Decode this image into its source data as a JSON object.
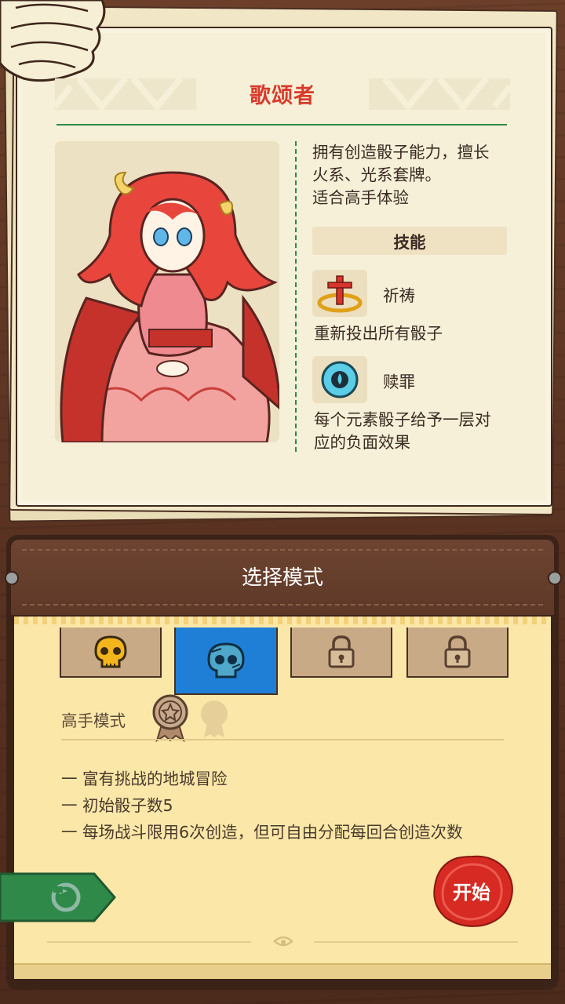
{
  "character": {
    "name": "歌颂者",
    "description_lines": [
      "拥有创造骰子能力，擅长",
      "火系、光系套牌。",
      "适合高手体验"
    ]
  },
  "skills": {
    "header": "技能",
    "items": [
      {
        "name": "祈祷",
        "description": "重新投出所有骰子",
        "icon": "golden-cross-icon"
      },
      {
        "name": "赎罪",
        "description_lines": [
          "每个元素骰子给予一层对",
          "应的负面效果"
        ],
        "icon": "blue-skull-icon"
      }
    ]
  },
  "mode_panel": {
    "title": "选择模式",
    "tabs": [
      {
        "icon": "gold-skull-icon",
        "state": "unlocked"
      },
      {
        "icon": "blue-skull-icon",
        "state": "selected"
      },
      {
        "icon": "lock-icon",
        "state": "locked"
      },
      {
        "icon": "lock-icon",
        "state": "locked"
      }
    ],
    "selected_mode": "高手模式",
    "medals": [
      "star-medal-icon",
      "empty-medal-icon"
    ],
    "features": [
      "富有挑战的地城冒险",
      "初始骰子数5",
      "每场战斗限用6次创造，但可自由分配每回合创造次数"
    ],
    "start_label": "开始",
    "back_icon": "back-arrow-icon"
  },
  "colors": {
    "title_red": "#d93a2b",
    "accent_green": "#2f8a4a",
    "selected_tab_blue": "#1f7fd6",
    "start_red": "#d62a22"
  }
}
